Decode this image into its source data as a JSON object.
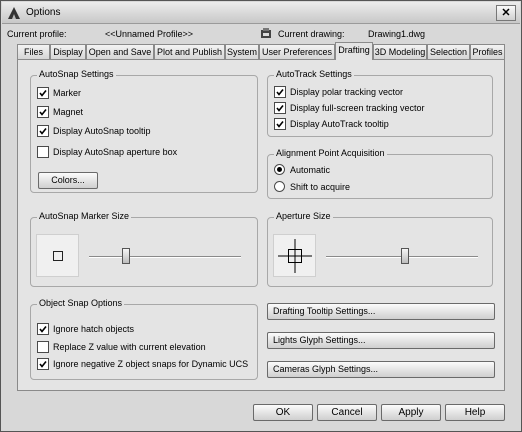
{
  "window": {
    "title": "Options",
    "close_label": "✕"
  },
  "profile": {
    "current_profile_label": "Current profile:",
    "current_profile_value": "<<Unnamed Profile>>",
    "current_drawing_label": "Current drawing:",
    "current_drawing_value": "Drawing1.dwg"
  },
  "tabs": [
    {
      "label": "Files"
    },
    {
      "label": "Display"
    },
    {
      "label": "Open and Save"
    },
    {
      "label": "Plot and Publish"
    },
    {
      "label": "System"
    },
    {
      "label": "User Preferences"
    },
    {
      "label": "Drafting",
      "active": true
    },
    {
      "label": "3D Modeling"
    },
    {
      "label": "Selection"
    },
    {
      "label": "Profiles"
    }
  ],
  "autosnap_settings": {
    "title": "AutoSnap Settings",
    "items": [
      {
        "label": "Marker",
        "checked": true
      },
      {
        "label": "Magnet",
        "checked": true
      },
      {
        "label": "Display AutoSnap tooltip",
        "checked": true
      },
      {
        "label": "Display AutoSnap aperture box",
        "checked": false
      }
    ],
    "colors_button": "Colors..."
  },
  "autotrack_settings": {
    "title": "AutoTrack Settings",
    "items": [
      {
        "label": "Display polar tracking vector",
        "checked": true
      },
      {
        "label": "Display full-screen tracking vector",
        "checked": true
      },
      {
        "label": "Display AutoTrack tooltip",
        "checked": true
      }
    ]
  },
  "alignment": {
    "title": "Alignment Point Acquisition",
    "options": [
      {
        "label": "Automatic",
        "selected": true
      },
      {
        "label": "Shift to acquire",
        "selected": false
      }
    ]
  },
  "marker_size": {
    "title": "AutoSnap Marker Size",
    "level": 0.23
  },
  "aperture_size": {
    "title": "Aperture Size",
    "level": 0.52
  },
  "object_snap_options": {
    "title": "Object Snap Options",
    "items": [
      {
        "label": "Ignore hatch objects",
        "checked": true
      },
      {
        "label": "Replace Z value with current elevation",
        "checked": false
      },
      {
        "label": "Ignore negative Z object snaps for Dynamic UCS",
        "checked": true
      }
    ]
  },
  "glyph_buttons": {
    "tooltip": "Drafting Tooltip Settings...",
    "lights": "Lights Glyph Settings...",
    "cameras": "Cameras Glyph Settings..."
  },
  "dialog_buttons": {
    "ok": "OK",
    "cancel": "Cancel",
    "apply": "Apply",
    "help": "Help"
  }
}
